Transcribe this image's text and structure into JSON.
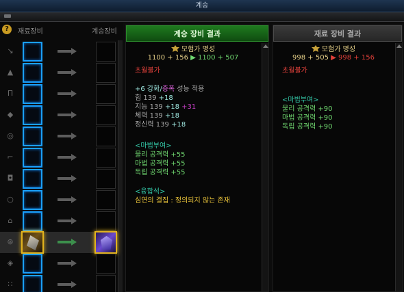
{
  "window": {
    "title": "계승"
  },
  "left_panel": {
    "col_material": "재료장비",
    "col_inherit": "계승장비",
    "help_icon": "question-icon",
    "rows": [
      {
        "slot": "weapon",
        "icon": "sword-icon"
      },
      {
        "slot": "top",
        "icon": "chest-armor-icon"
      },
      {
        "slot": "bottom",
        "icon": "pants-icon"
      },
      {
        "slot": "shoulder",
        "icon": "shoulder-icon"
      },
      {
        "slot": "belt",
        "icon": "belt-icon"
      },
      {
        "slot": "shoes",
        "icon": "boots-icon"
      },
      {
        "slot": "bracelet",
        "icon": "bracelet-icon"
      },
      {
        "slot": "necklace",
        "icon": "necklace-icon"
      },
      {
        "slot": "ring",
        "icon": "ring-icon"
      },
      {
        "slot": "support",
        "icon": "support-icon",
        "selected": true
      },
      {
        "slot": "magic-stone",
        "icon": "magic-stone-icon"
      },
      {
        "slot": "earring",
        "icon": "earring-icon"
      }
    ]
  },
  "center_panel": {
    "header": "계승 장비 결과",
    "fame_label": "모험가 명성",
    "fame_before": "1100 + 156",
    "fame_arrow": "▶",
    "fame_after": "1100 + 507",
    "transcend": "초월불가",
    "upgrade_prefix": "+6 강화/",
    "upgrade_amp": "증폭",
    "upgrade_suffix": "성능 적용",
    "stats": [
      {
        "name": "힘",
        "base": "139",
        "add": "+18"
      },
      {
        "name": "지능",
        "base": "139",
        "add": "+18",
        "extra": "+31"
      },
      {
        "name": "체력",
        "base": "139",
        "add": "+18"
      },
      {
        "name": "정신력",
        "base": "139",
        "add": "+18"
      }
    ],
    "enchant_header": "<마법부여>",
    "enchant": [
      {
        "name": "물리 공격력",
        "value": "+55"
      },
      {
        "name": "마법 공격력",
        "value": "+55"
      },
      {
        "name": "독립 공격력",
        "value": "+55"
      }
    ],
    "fusion_header": "<융합석>",
    "fusion_value": "심연의 결집 : 정의되지 않는 존재"
  },
  "right_panel": {
    "header": "재료 장비 결과",
    "fame_label": "모험가 명성",
    "fame_before": "998 + 505",
    "fame_arrow": "▶",
    "fame_after": "998 + 156",
    "transcend": "초월불가",
    "enchant_header": "<마법부여>",
    "enchant": [
      {
        "name": "물리 공격력",
        "value": "+90"
      },
      {
        "name": "마법 공격력",
        "value": "+90"
      },
      {
        "name": "독립 공격력",
        "value": "+90"
      }
    ]
  },
  "colors": {
    "selected_header": "#1f7a1f",
    "slot_border": "#1aa0ff",
    "gold_frame": "#e2b31e"
  }
}
